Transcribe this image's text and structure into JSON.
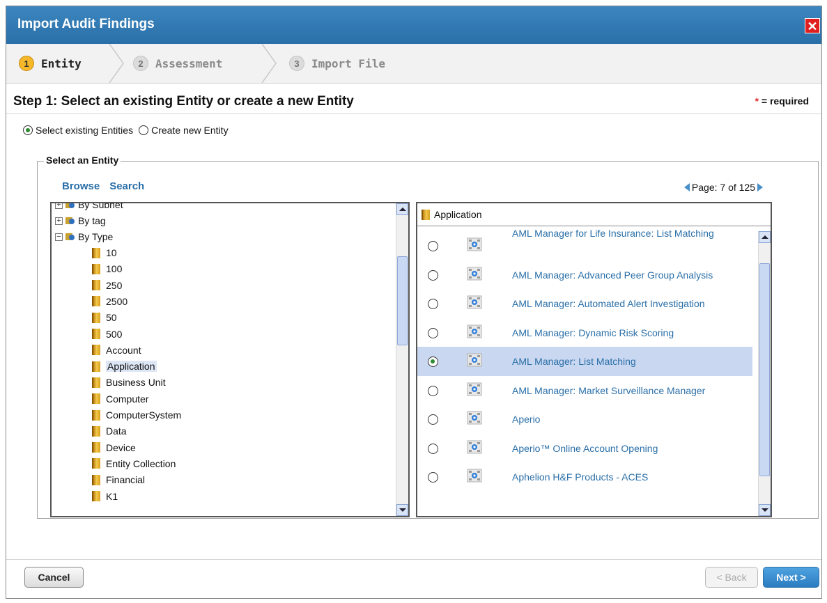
{
  "dialog": {
    "title": "Import Audit Findings",
    "close_icon": "close-icon"
  },
  "wizard": {
    "steps": [
      {
        "num": "1",
        "label": "Entity",
        "active": true
      },
      {
        "num": "2",
        "label": "Assessment",
        "active": false
      },
      {
        "num": "3",
        "label": "Import File",
        "active": false
      }
    ]
  },
  "step": {
    "title": "Step 1: Select an existing Entity or create a new Entity",
    "required_star": "*",
    "required_text": " = required"
  },
  "mode": {
    "existing_label": "Select existing Entities",
    "new_label": "Create new Entity",
    "selected": "existing"
  },
  "select_group": {
    "legend": "Select an Entity",
    "browse": "Browse",
    "search": "Search",
    "page": "Page: 7 of 125"
  },
  "tree": {
    "top_items": [
      {
        "label": "By Subnet",
        "expander": "+"
      },
      {
        "label": "By tag",
        "expander": "+"
      },
      {
        "label": "By Type",
        "expander": "−"
      }
    ],
    "type_items": [
      "10",
      "100",
      "250",
      "2500",
      "50",
      "500",
      "Account",
      "Application",
      "Business Unit",
      "Computer",
      "ComputerSystem",
      "Data",
      "Device",
      "Entity Collection",
      "Financial",
      "K1"
    ],
    "selected": "Application"
  },
  "grid": {
    "folder": "Application",
    "rows": [
      {
        "label": "AML Manager for Life Insurance: List Matching",
        "selected": false
      },
      {
        "label": "AML Manager: Advanced Peer Group Analysis",
        "selected": false
      },
      {
        "label": "AML Manager: Automated Alert Investigation",
        "selected": false
      },
      {
        "label": "AML Manager: Dynamic Risk Scoring",
        "selected": false
      },
      {
        "label": "AML Manager: List Matching",
        "selected": true
      },
      {
        "label": "AML Manager: Market Surveillance Manager",
        "selected": false
      },
      {
        "label": "Aperio",
        "selected": false
      },
      {
        "label": "Aperio™ Online Account Opening",
        "selected": false
      },
      {
        "label": "Aphelion H&F Products - ACES",
        "selected": false
      }
    ]
  },
  "footer": {
    "cancel": "Cancel",
    "back": "< Back",
    "next": "Next >"
  },
  "colors": {
    "title_bar": "#2f78b4",
    "link": "#2a6fa8",
    "selected_row": "#c9d7f0",
    "active_step": "#f5b82a"
  }
}
